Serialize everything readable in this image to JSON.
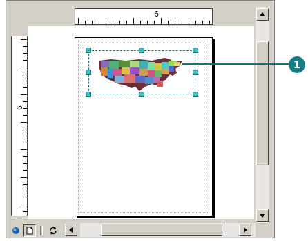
{
  "rulers": {
    "horizontal_label": "6",
    "vertical_label": "6"
  },
  "map": {
    "icon": "usa-states-map-icon"
  },
  "callout": {
    "number": "1",
    "color": "#1a7d86"
  },
  "colors": {
    "selection": "#1a6e78",
    "handle": "#3fbfb8",
    "chrome": "#d4d0c8"
  },
  "toolbar": {
    "icons": [
      "data-view-icon",
      "layout-view-icon",
      "refresh-icon"
    ]
  },
  "scrollbars": {
    "vertical_up": "scroll-up-arrow-icon",
    "vertical_down": "scroll-down-arrow-icon",
    "horizontal_left": "scroll-left-arrow-icon",
    "horizontal_right": "scroll-right-arrow-icon"
  }
}
